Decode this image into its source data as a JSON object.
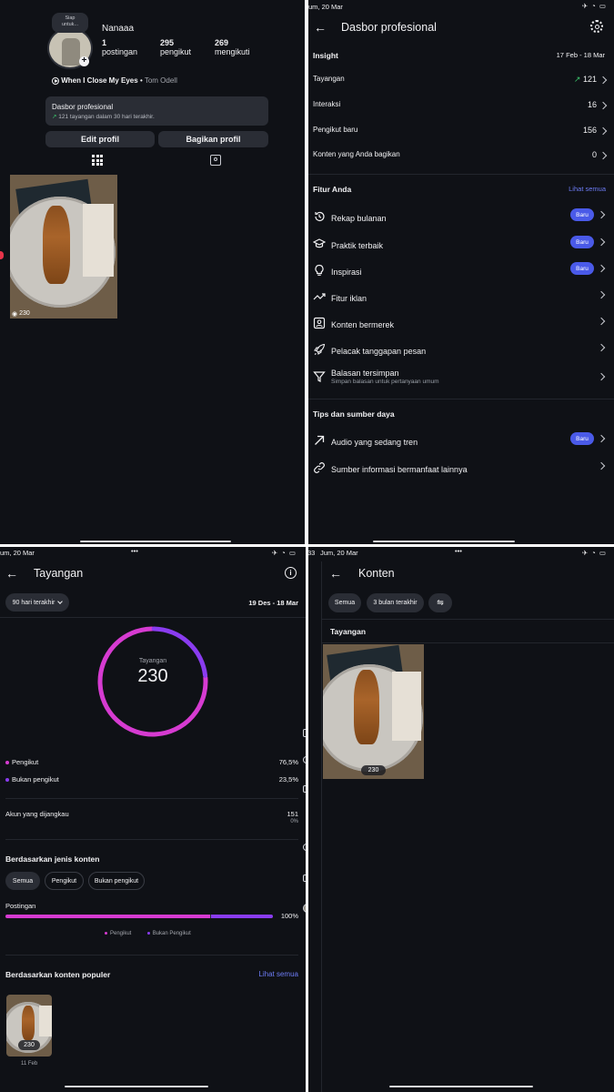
{
  "profile": {
    "note_line1": "Siap",
    "note_line2": "untuk...",
    "name": "Nanaaa",
    "stats": [
      {
        "value": "1",
        "label": "postingan"
      },
      {
        "value": "295",
        "label": "pengikut"
      },
      {
        "value": "269",
        "label": "mengikuti"
      }
    ],
    "music_title": "When I Close My Eyes",
    "music_sep": "•",
    "music_artist": "Tom Odell",
    "dashboard_title": "Dasbor profesional",
    "dashboard_sub": "121 tayangan dalam 30 hari terakhir.",
    "edit_button": "Edit profil",
    "share_button": "Bagikan profil",
    "post_views": "230"
  },
  "dashboard": {
    "status_time": "um, 20 Mar",
    "title": "Dasbor profesional",
    "insight_header": "Insight",
    "date_range": "17 Feb - 18 Mar",
    "insights": [
      {
        "label": "Tayangan",
        "value": "121",
        "trend": "↗"
      },
      {
        "label": "Interaksi",
        "value": "16",
        "trend": ""
      },
      {
        "label": "Pengikut baru",
        "value": "156",
        "trend": ""
      },
      {
        "label": "Konten yang Anda bagikan",
        "value": "0",
        "trend": ""
      }
    ],
    "features_header": "Fitur Anda",
    "see_all": "Lihat semua",
    "features": [
      {
        "label": "Rekap bulanan",
        "badge": "Baru",
        "sub": ""
      },
      {
        "label": "Praktik terbaik",
        "badge": "Baru",
        "sub": ""
      },
      {
        "label": "Inspirasi",
        "badge": "Baru",
        "sub": ""
      },
      {
        "label": "Fitur iklan",
        "badge": "",
        "sub": ""
      },
      {
        "label": "Konten bermerek",
        "badge": "",
        "sub": ""
      },
      {
        "label": "Pelacak tanggapan pesan",
        "badge": "",
        "sub": ""
      },
      {
        "label": "Balasan tersimpan",
        "badge": "",
        "sub": "Simpan balasan untuk pertanyaan umum"
      }
    ],
    "tips_header": "Tips dan sumber daya",
    "tips": [
      {
        "label": "Audio yang sedang tren",
        "badge": "Baru"
      },
      {
        "label": "Sumber informasi bermanfaat lainnya",
        "badge": ""
      }
    ]
  },
  "views": {
    "status_time": "um, 20 Mar",
    "status_dots": "•••",
    "title": "Tayangan",
    "range_select": "90 hari terakhir",
    "date_range": "19 Des - 18 Mar",
    "ring_label": "Tayangan",
    "ring_value": "230",
    "breakdown": [
      {
        "label": "Pengikut",
        "value": "76,5%",
        "color": "#d63bd1"
      },
      {
        "label": "Bukan pengikut",
        "value": "23,5%",
        "color": "#8a3cf0"
      }
    ],
    "reached_label": "Akun yang dijangkau",
    "reached_value": "151",
    "reached_change": "0%",
    "content_type_header": "Berdasarkan jenis konten",
    "filters": [
      "Semua",
      "Pengikut",
      "Bukan pengikut"
    ],
    "post_type_label": "Postingan",
    "post_type_value": "100%",
    "legend": [
      "Pengikut",
      "Bukan Pengikut"
    ],
    "popular_header": "Berdasarkan konten populer",
    "popular_see_all": "Lihat semua",
    "popular_views": "230",
    "popular_date": "11 Feb",
    "notif_count": "1"
  },
  "content": {
    "status_num": "33",
    "status_time": "Jum, 20 Mar",
    "status_dots": "•••",
    "title": "Konten",
    "filters": [
      "Semua",
      "3 bulan terakhir"
    ],
    "section_header": "Tayangan",
    "post_views": "230"
  },
  "chart_data": {
    "type": "pie",
    "categories": [
      "Pengikut",
      "Bukan pengikut"
    ],
    "values": [
      76.5,
      23.5
    ],
    "total": 230
  },
  "colors": {
    "background": "#0f1116",
    "accent_blue": "#4a5ae8",
    "followers": "#d63bd1",
    "non_followers": "#8a3cf0",
    "trend_green": "#3bc46b"
  }
}
